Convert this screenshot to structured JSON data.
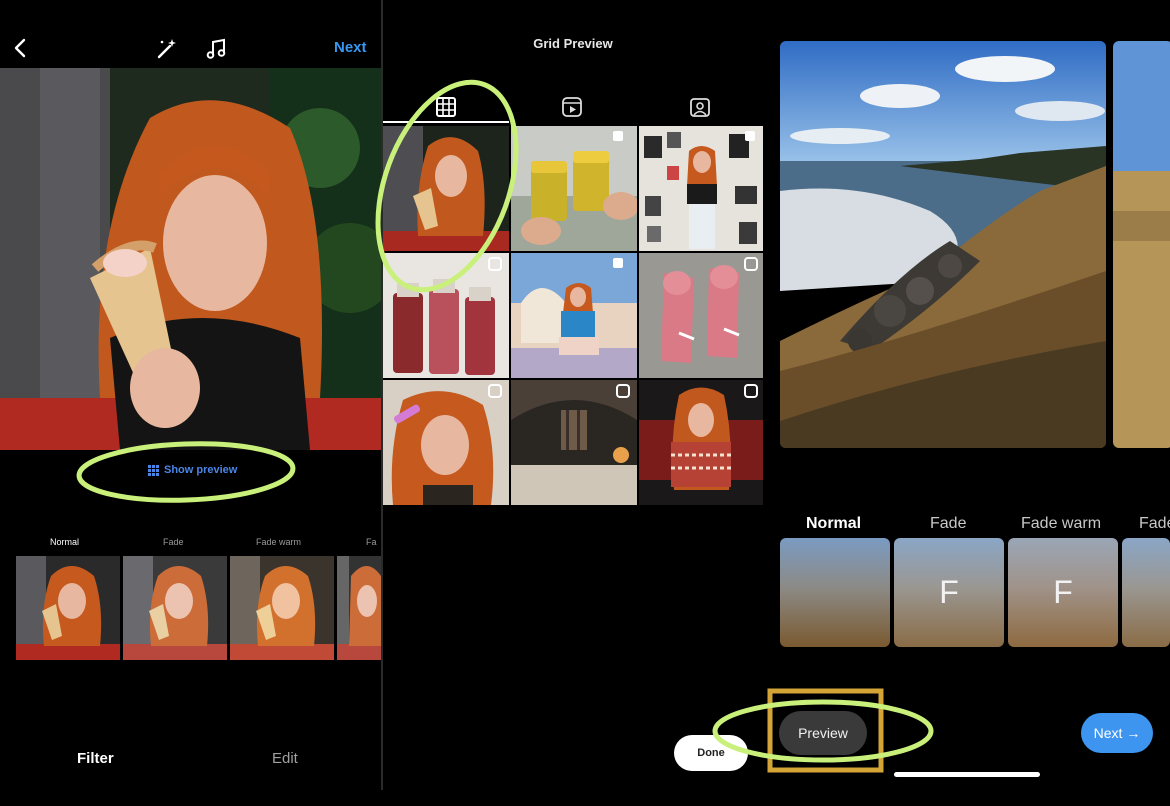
{
  "left_panel": {
    "next_label": "Next",
    "show_preview_label": "Show preview",
    "filters": [
      "Normal",
      "Fade",
      "Fade warm",
      "Fa"
    ],
    "tabs": {
      "filter": "Filter",
      "edit": "Edit"
    }
  },
  "middle_panel": {
    "title": "Grid Preview"
  },
  "right_panel": {
    "filters": [
      "Normal",
      "Fade",
      "Fade warm",
      "Fade"
    ],
    "filter_letters": [
      "F",
      "F"
    ],
    "done_label": "Done",
    "preview_label": "Preview",
    "next_label": "Next"
  },
  "colors": {
    "accent_blue": "#3897f0",
    "annotation_green": "#c8f07a",
    "annotation_orange": "#d4a437"
  }
}
